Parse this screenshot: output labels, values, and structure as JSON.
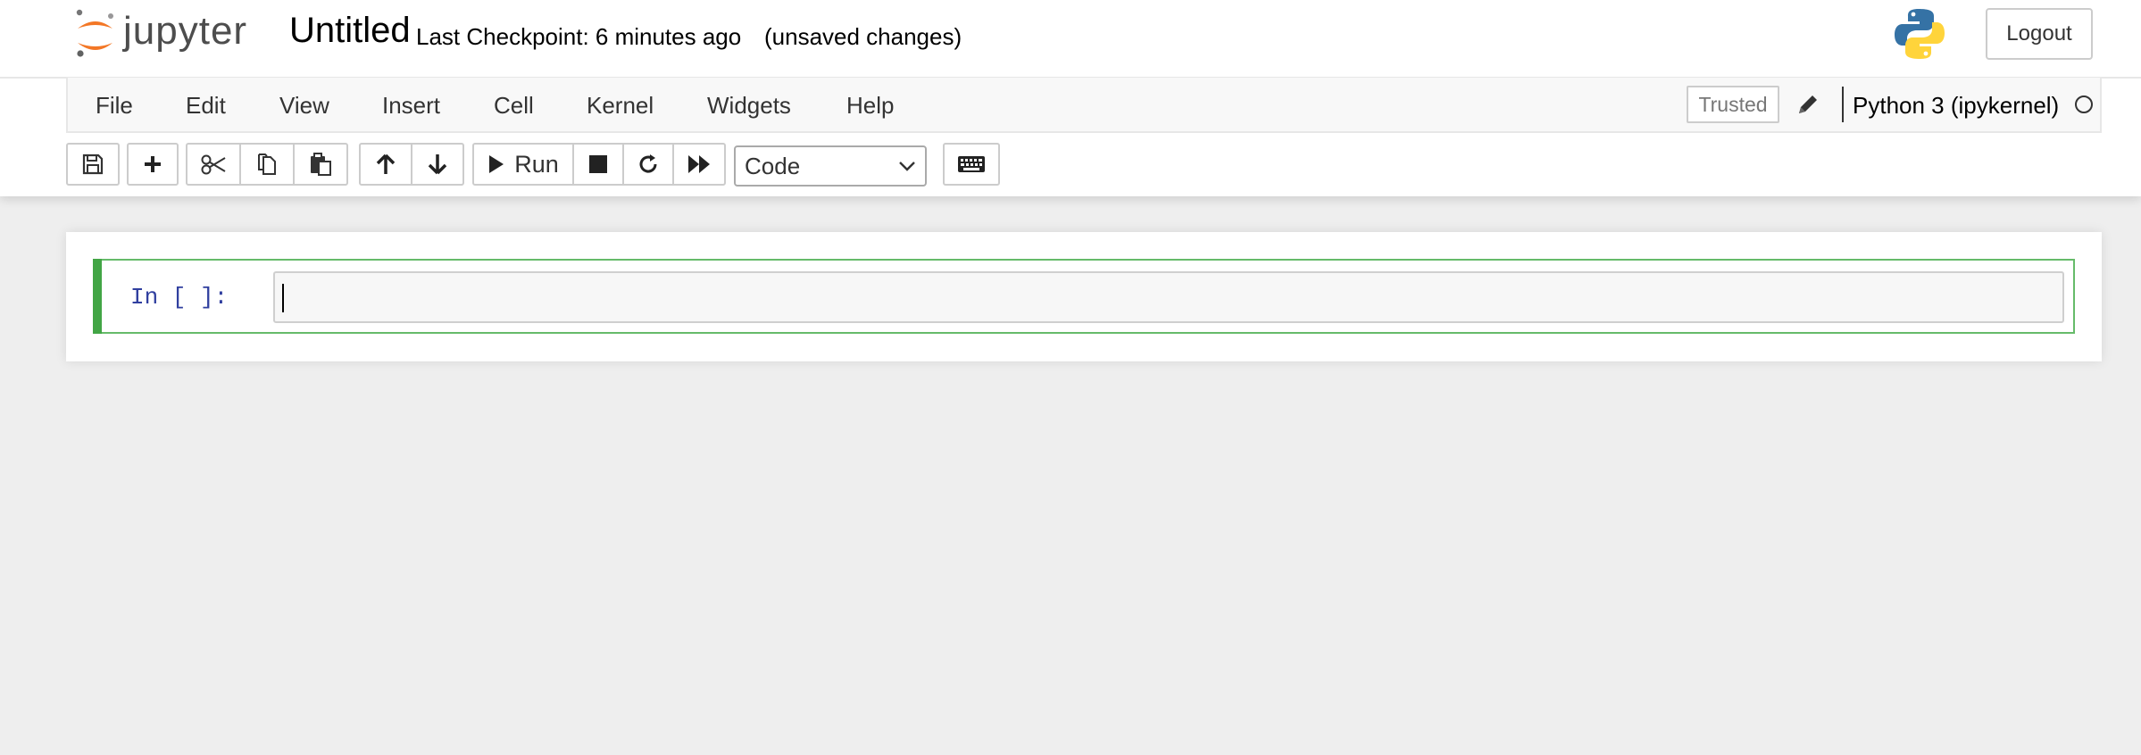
{
  "header": {
    "logo_text": "jupyter",
    "notebook_title": "Untitled",
    "checkpoint": "Last Checkpoint: 6 minutes ago",
    "save_status": "(unsaved changes)",
    "logout_label": "Logout",
    "python_logo_colors": [
      "#3572a5",
      "#ffd43b"
    ],
    "jupyter_orange": "#f37726"
  },
  "menu": {
    "items": [
      {
        "label": "File"
      },
      {
        "label": "Edit"
      },
      {
        "label": "View"
      },
      {
        "label": "Insert"
      },
      {
        "label": "Cell"
      },
      {
        "label": "Kernel"
      },
      {
        "label": "Widgets"
      },
      {
        "label": "Help"
      }
    ],
    "trusted_label": "Trusted",
    "kernel_name": "Python 3 (ipykernel)",
    "kernel_status": "idle"
  },
  "toolbar": {
    "buttons": [
      {
        "icon": "save-icon"
      },
      {
        "icon": "plus-icon"
      },
      {
        "icon": "scissors-icon"
      },
      {
        "icon": "copy-icon"
      },
      {
        "icon": "paste-icon"
      },
      {
        "icon": "arrow-up-icon"
      },
      {
        "icon": "arrow-down-icon"
      },
      {
        "icon": "play-icon"
      },
      {
        "icon": "stop-icon"
      },
      {
        "icon": "restart-icon"
      },
      {
        "icon": "fast-forward-icon"
      },
      {
        "icon": "keyboard-icon"
      }
    ],
    "run_label": "Run",
    "cell_type": "Code"
  },
  "cell": {
    "prompt": "In [ ]:",
    "code": "",
    "border_color": "#66bb6a",
    "bar_color": "#42a545"
  }
}
